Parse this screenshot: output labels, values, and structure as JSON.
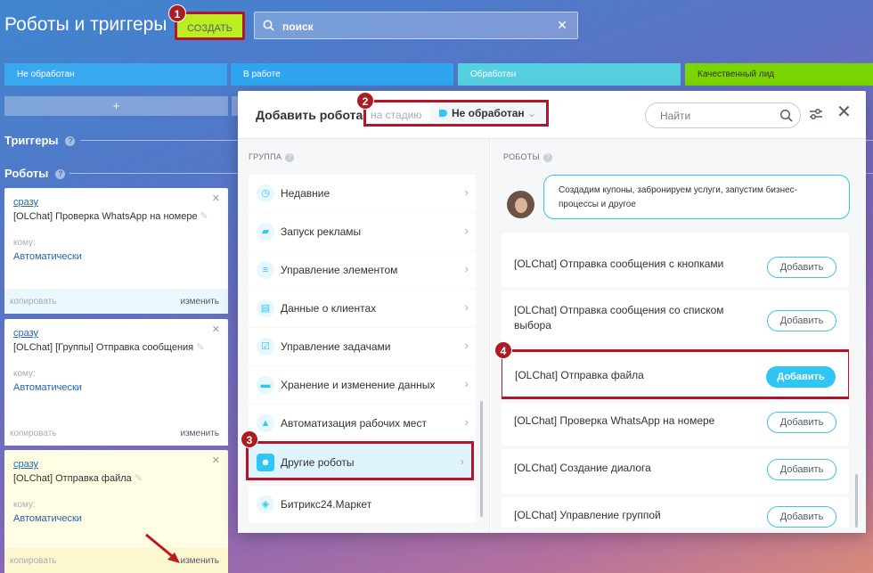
{
  "page": {
    "title": "Роботы и триггеры"
  },
  "toolbar": {
    "create_label": "СОЗДАТЬ",
    "search_value": "поиск"
  },
  "markers": [
    "1",
    "2",
    "3",
    "4"
  ],
  "stages": [
    {
      "label": "Не обработан",
      "color": "#39a8ef"
    },
    {
      "label": "В работе",
      "color": "#2fa5ef"
    },
    {
      "label": "Обработан",
      "color": "#55d0e0"
    },
    {
      "label": "Качественный лид",
      "color": "#7bd500"
    }
  ],
  "add_row": {
    "label": "+"
  },
  "sections": {
    "triggers": "Триггеры",
    "robots": "Роботы",
    "help": "?"
  },
  "cards": [
    {
      "when": "сразу",
      "name": "[OLChat] Проверка WhatsApp на номере",
      "to_label": "кому:",
      "to_value": "Автоматически",
      "copy": "копировать",
      "edit": "изменить"
    },
    {
      "when": "сразу",
      "name": "[OLChat] [Группы] Отправка сообщения",
      "to_label": "кому:",
      "to_value": "Автоматически",
      "copy": "копировать",
      "edit": "изменить"
    },
    {
      "when": "сразу",
      "name": "[OLChat] Отправка файла",
      "to_label": "кому:",
      "to_value": "Автоматически",
      "copy": "копировать",
      "edit": "изменить"
    }
  ],
  "modal": {
    "title": "Добавить робота",
    "stage_label": "на стадию",
    "stage_value": "Не обработан",
    "find_placeholder": "Найти",
    "groups_header": "ГРУППА",
    "robots_header": "РОБОТЫ",
    "groups": [
      {
        "label": "Недавние",
        "icon": "clock-icon"
      },
      {
        "label": "Запуск рекламы",
        "icon": "megaphone-icon"
      },
      {
        "label": "Управление элементом",
        "icon": "filter-icon"
      },
      {
        "label": "Данные о клиентах",
        "icon": "id-card-icon"
      },
      {
        "label": "Управление задачами",
        "icon": "task-icon"
      },
      {
        "label": "Хранение и изменение данных",
        "icon": "database-icon"
      },
      {
        "label": "Автоматизация рабочих мест",
        "icon": "workplace-icon"
      },
      {
        "label": "Другие роботы",
        "icon": "robot-icon"
      },
      {
        "label": "Битрикс24.Маркет",
        "icon": "market-icon"
      }
    ],
    "bubble_text": "Создадим купоны, забронируем услуги, запустим бизнес-процессы и другое",
    "add_label": "Добавить",
    "robots": [
      "[OLChat] Отправка сообщения с кнопками",
      "[OLChat] Отправка сообщения со списком выбора",
      "[OLChat] Отправка файла",
      "[OLChat] Проверка WhatsApp на номере",
      "[OLChat] Создание диалога",
      "[OLChat] Управление группой"
    ]
  }
}
